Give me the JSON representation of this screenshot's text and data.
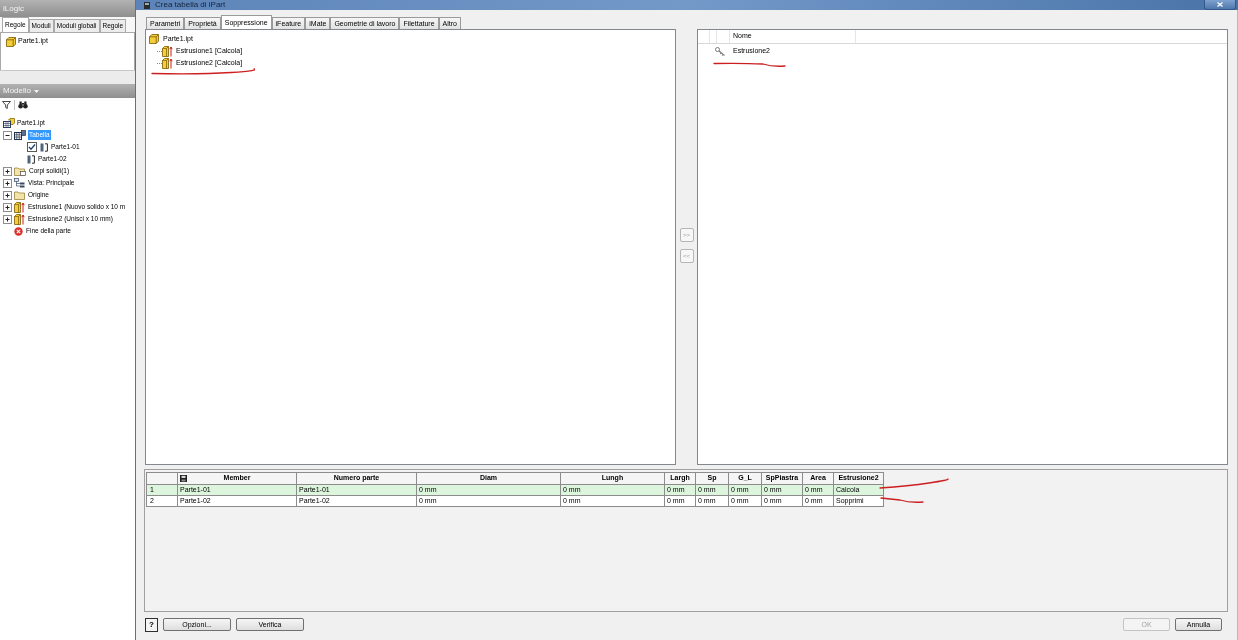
{
  "ilogic_panel": {
    "title": "iLogic",
    "tabs": [
      {
        "label": "Regole",
        "selected": true
      },
      {
        "label": "Moduli",
        "selected": false
      },
      {
        "label": "Moduli globali",
        "selected": false
      },
      {
        "label": "Regole",
        "selected": false
      }
    ],
    "items": [
      {
        "label": "Parte1.ipt",
        "kind": "part",
        "selected": false
      }
    ]
  },
  "model_browser": {
    "title": "Modello",
    "tree": [
      {
        "label": "Parte1.ipt",
        "kind": "table_part",
        "selected": false,
        "children": [
          {
            "label": "Tabella",
            "kind": "table",
            "selected": true,
            "expanded": true,
            "children": [
              {
                "label": "Parte1-01",
                "kind": "member",
                "selected": false,
                "checked": true
              },
              {
                "label": "Parte1-02",
                "kind": "member",
                "selected": false,
                "checked": false
              }
            ]
          },
          {
            "label": "Corpi solidi(1)",
            "kind": "bodies",
            "selected": false,
            "expanded": false
          },
          {
            "label": "Vista: Principale",
            "kind": "view",
            "selected": false,
            "expanded": false
          },
          {
            "label": "Origine",
            "kind": "folder",
            "selected": false,
            "expanded": false
          },
          {
            "label": "Estrusione1 (Nuovo solido x 10 m",
            "kind": "extrusion",
            "selected": false,
            "expanded": false
          },
          {
            "label": "Estrusione2 (Unisci x 10 mm)",
            "kind": "extrusion",
            "selected": false,
            "expanded": false
          },
          {
            "label": "Fine della parte",
            "kind": "end",
            "selected": false
          }
        ]
      }
    ]
  },
  "dialog": {
    "title": "Crea tabella di iPart",
    "tabs": [
      {
        "label": "Parametri",
        "selected": false
      },
      {
        "label": "Proprietà",
        "selected": false
      },
      {
        "label": "Soppressione",
        "selected": true
      },
      {
        "label": "iFeature",
        "selected": false
      },
      {
        "label": "iMate",
        "selected": false
      },
      {
        "label": "Geometrie di lavoro",
        "selected": false
      },
      {
        "label": "Filettature",
        "selected": false
      },
      {
        "label": "Altro",
        "selected": false
      }
    ],
    "feature_tree": [
      {
        "label": "Parte1.ipt",
        "kind": "part",
        "selected": false,
        "children": [
          {
            "label": "Estrusione1 [Calcola]",
            "kind": "extrusion",
            "selected": false
          },
          {
            "label": "Estrusione2 [Calcola]",
            "kind": "extrusion",
            "selected": false
          }
        ]
      }
    ],
    "move_buttons": [
      ">>",
      "<<"
    ],
    "suppressed_list": {
      "columns": [
        "Nome"
      ],
      "rows": [
        {
          "name": "Estrusione2",
          "selected": false
        }
      ]
    },
    "table": {
      "columns": [
        "Member",
        "Numero parte",
        "Diam",
        "Lungh",
        "Largh",
        "Sp",
        "G_L",
        "SpPiastra",
        "Area",
        "Estrusione2"
      ],
      "rows": [
        {
          "number": "1",
          "default": true,
          "cells": [
            "Parte1-01",
            "Parte1-01",
            "0 mm",
            "0 mm",
            "0 mm",
            "0 mm",
            "0 mm",
            "0 mm",
            "0 mm",
            "Calcola"
          ]
        },
        {
          "number": "2",
          "default": false,
          "cells": [
            "Parte1-02",
            "Parte1-02",
            "0 mm",
            "0 mm",
            "0 mm",
            "0 mm",
            "0 mm",
            "0 mm",
            "0 mm",
            "Sopprimi"
          ]
        }
      ]
    },
    "footer": {
      "help": "?",
      "buttons": [
        {
          "label": "Opzioni...",
          "disabled": false
        },
        {
          "label": "Verifica",
          "disabled": false
        }
      ],
      "dialog_buttons": [
        {
          "label": "OK",
          "disabled": true
        },
        {
          "label": "Annulla",
          "disabled": false
        }
      ]
    }
  }
}
